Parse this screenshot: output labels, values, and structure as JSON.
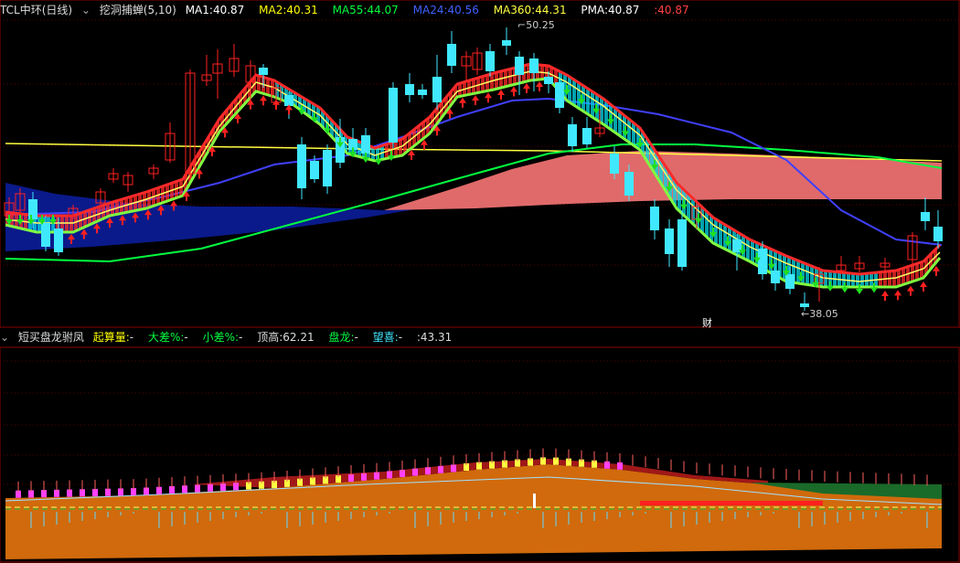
{
  "colors": {
    "bg": "#000000",
    "frame": "#8b0000",
    "grid": "#5a0000",
    "up": "#ff2020",
    "down": "#40e8ff",
    "ma1": "#ffffff",
    "ma2": "#ffff00",
    "ma55": "#00ff40",
    "ma24": "#4040ff",
    "ma360": "#ffff40",
    "pma": "#ffffff",
    "cloud_blue": "#0a1a8a",
    "cloud_pink": "#e06a6a",
    "ribbon_red": "#ff2a2a",
    "ribbon_cyan": "#00d8e8",
    "ribbon_green": "#80ff40",
    "sub_orange": "#d06a0c",
    "sub_darkred": "#a01818",
    "sub_green": "#1a6a2a"
  },
  "main_header": {
    "symbol": "TCL中环(日线)",
    "indicator": "挖洞捕蝉(5,10)",
    "ma1_label": "MA1:",
    "ma1_value": "40.87",
    "ma2_label": "MA2:",
    "ma2_value": "40.31",
    "ma55_label": "MA55:",
    "ma55_value": "44.07",
    "ma24_label": "MA24:",
    "ma24_value": "40.56",
    "ma360_label": "MA360:",
    "ma360_value": "44.31",
    "pma_label": "PMA:",
    "pma_value": "40.87",
    "extra_label": ":",
    "extra_value": "40.87"
  },
  "main_annotations": {
    "high": "50.25",
    "low": "38.05",
    "finance_marker": "财"
  },
  "sub_header": {
    "indicator": "短买盘龙驸凤",
    "a_label": "起算量:",
    "a_value": "-",
    "b_label": "大差%:",
    "b_value": "-",
    "c_label": "小差%:",
    "c_value": "-",
    "d_label": "顶高:",
    "d_value": "62.21",
    "e_label": "盘龙:",
    "e_value": "-",
    "f_label": "望喜:",
    "f_value": "-",
    "g_label": ":",
    "g_value": "43.31"
  }
}
